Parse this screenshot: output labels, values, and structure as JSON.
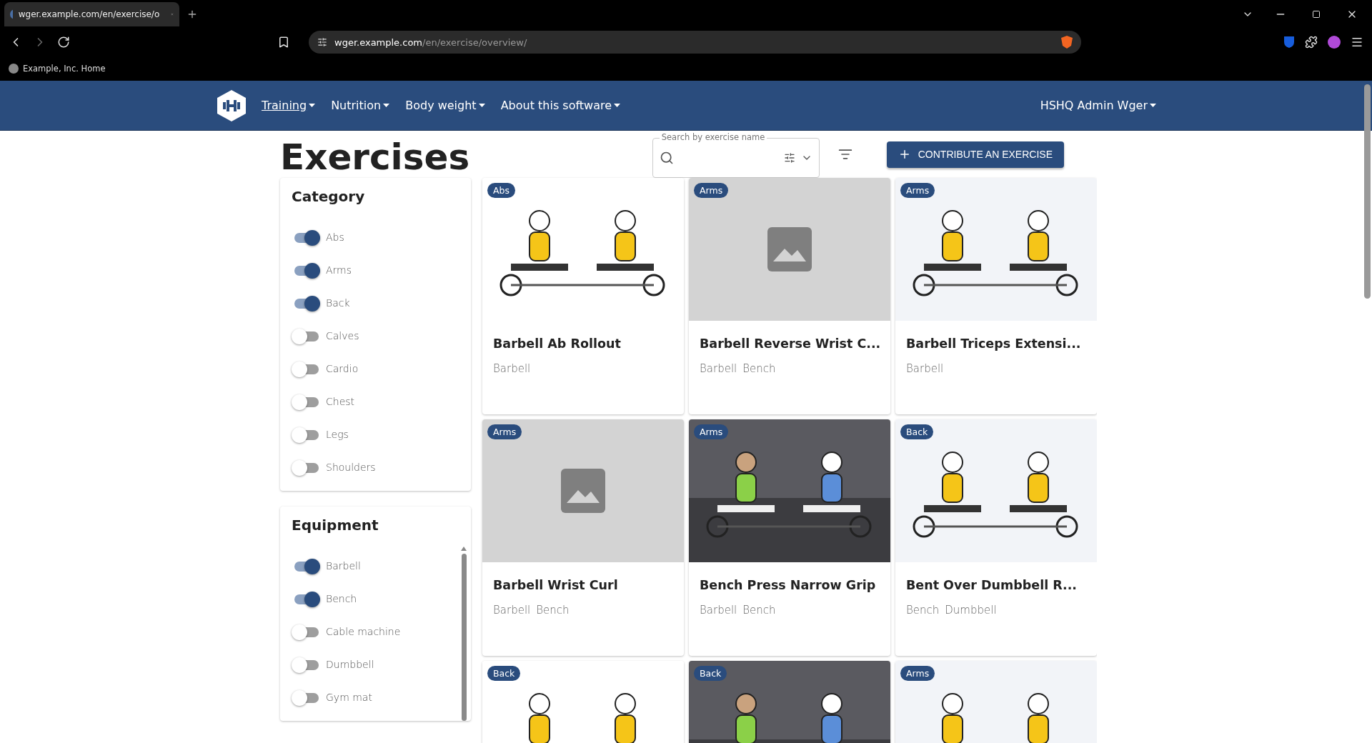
{
  "browser": {
    "tab_title": "wger.example.com/en/exercise/o",
    "address_host": "wger.example.com",
    "address_path": "/en/exercise/overview/",
    "bookmark": "Example, Inc. Home"
  },
  "navbar": {
    "items": [
      {
        "label": "Training",
        "selected": true
      },
      {
        "label": "Nutrition",
        "selected": false
      },
      {
        "label": "Body weight",
        "selected": false
      },
      {
        "label": "About this software",
        "selected": false
      }
    ],
    "user": "HSHQ Admin Wger"
  },
  "page": {
    "title": "Exercises",
    "search": {
      "placeholder": "Search by exercise name"
    },
    "contribute_button": "CONTRIBUTE AN EXERCISE"
  },
  "filters": [
    {
      "title": "Category",
      "scrollable": false,
      "items": [
        {
          "label": "Abs",
          "on": true
        },
        {
          "label": "Arms",
          "on": true
        },
        {
          "label": "Back",
          "on": true
        },
        {
          "label": "Calves",
          "on": false
        },
        {
          "label": "Cardio",
          "on": false
        },
        {
          "label": "Chest",
          "on": false
        },
        {
          "label": "Legs",
          "on": false
        },
        {
          "label": "Shoulders",
          "on": false
        }
      ]
    },
    {
      "title": "Equipment",
      "scrollable": true,
      "items": [
        {
          "label": "Barbell",
          "on": true
        },
        {
          "label": "Bench",
          "on": true
        },
        {
          "label": "Cable machine",
          "on": false
        },
        {
          "label": "Dumbbell",
          "on": false
        },
        {
          "label": "Gym mat",
          "on": false
        }
      ]
    }
  ],
  "exercises": [
    {
      "category": "Abs",
      "kind": "picture",
      "name": "Barbell Ab Rollout",
      "equipment": [
        "Barbell"
      ]
    },
    {
      "category": "Arms",
      "kind": "placeholder",
      "name": "Barbell Reverse Wrist C...",
      "equipment": [
        "Barbell",
        "Bench"
      ]
    },
    {
      "category": "Arms",
      "kind": "picture",
      "name": "Barbell Triceps Extensi...",
      "equipment": [
        "Barbell"
      ]
    },
    {
      "category": "Arms",
      "kind": "placeholder",
      "name": "Barbell Wrist Curl",
      "equipment": [
        "Barbell",
        "Bench"
      ]
    },
    {
      "category": "Arms",
      "kind": "picture",
      "name": "Bench Press Narrow Grip",
      "equipment": [
        "Barbell",
        "Bench"
      ]
    },
    {
      "category": "Back",
      "kind": "picture",
      "name": "Bent Over Dumbbell R...",
      "equipment": [
        "Bench",
        "Dumbbell"
      ]
    },
    {
      "category": "Back",
      "kind": "picture"
    },
    {
      "category": "Back",
      "kind": "picture"
    },
    {
      "category": "Arms",
      "kind": "picture"
    }
  ]
}
